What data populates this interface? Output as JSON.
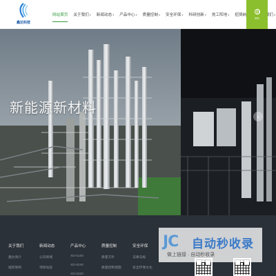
{
  "brand": {
    "name": "鑫达科技"
  },
  "nav": {
    "items": [
      {
        "label": "网站首页",
        "active": true,
        "caret": false
      },
      {
        "label": "关于我们",
        "active": false,
        "caret": true
      },
      {
        "label": "新闻动态",
        "active": false,
        "caret": true
      },
      {
        "label": "产品中心",
        "active": false,
        "caret": true
      },
      {
        "label": "质量控制",
        "active": false,
        "caret": true
      },
      {
        "label": "安全环保",
        "active": false,
        "caret": true
      },
      {
        "label": "科研创新",
        "active": false,
        "caret": true
      },
      {
        "label": "党工阵地",
        "active": false,
        "caret": true
      },
      {
        "label": "招贤纳士",
        "active": false,
        "caret": true
      },
      {
        "label": "联系我们",
        "active": false,
        "caret": true
      }
    ],
    "caret_glyph": "▾",
    "lang_label": "EN"
  },
  "banner": {
    "title": "新能源新材料",
    "next_arrow": "›"
  },
  "footer": {
    "columns": [
      {
        "heading": "关于我们",
        "links": [
          "鑫达简介",
          "组织架构",
          "企业文化"
        ]
      },
      {
        "heading": "新闻动态",
        "links": [
          "公司新闻",
          "项目动态",
          "三会动态"
        ]
      },
      {
        "heading": "产品中心",
        "links": [
          "XD-5100",
          "XD-5240",
          "XD-5320"
        ]
      },
      {
        "heading": "质量控制",
        "links": [
          "质量方针",
          "质量控制措施",
          "质量荣誉"
        ]
      },
      {
        "heading": "安全环保",
        "links": [
          "法律法规",
          "安全环保文化",
          "安全动态"
        ]
      }
    ]
  },
  "watermark": {
    "logo": "JC",
    "title": "自动秒收录",
    "subtitle": "做上链接 · 自动秒收录"
  },
  "colors": {
    "accent": "#2f9a3a",
    "lang_bg": "#8bbf2d",
    "footer_bg": "#2b3138",
    "brand_blue": "#1a5aa8"
  }
}
